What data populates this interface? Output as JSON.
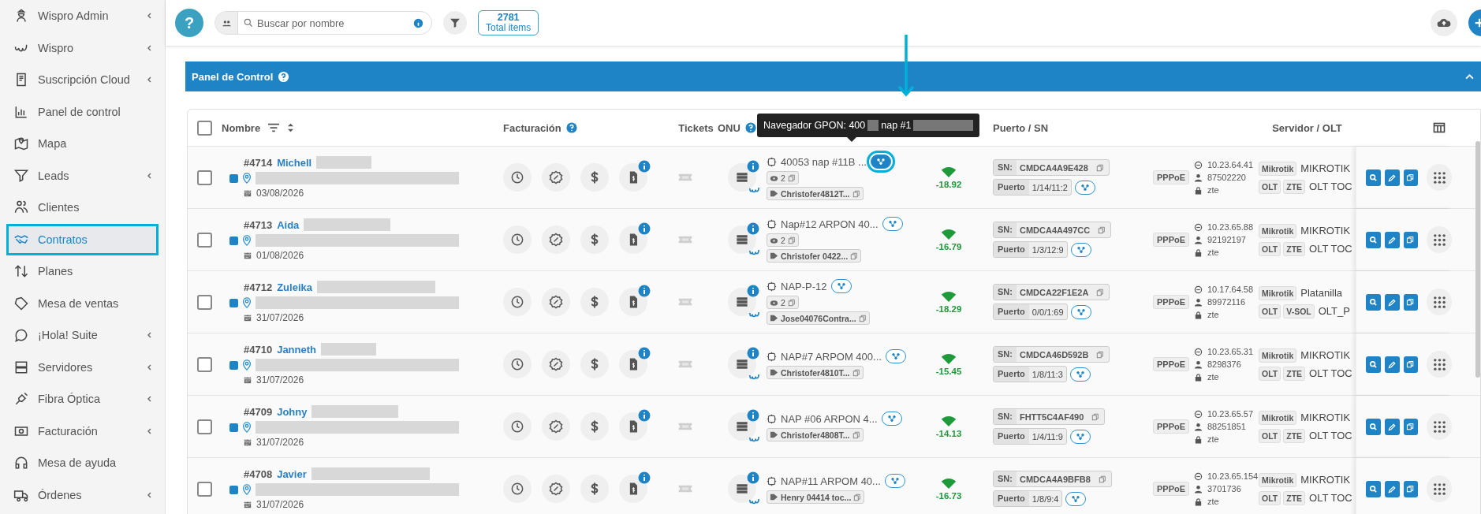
{
  "sidebar": {
    "items": [
      {
        "label": "Wispro Admin",
        "expandable": true,
        "selected": false,
        "highlighted": false
      },
      {
        "label": "Wispro",
        "expandable": true,
        "selected": false,
        "highlighted": false
      },
      {
        "label": "Suscripción Cloud",
        "expandable": true,
        "selected": false,
        "highlighted": false
      },
      {
        "label": "Panel de control",
        "expandable": false,
        "selected": false,
        "highlighted": false
      },
      {
        "label": "Mapa",
        "expandable": false,
        "selected": false,
        "highlighted": false
      },
      {
        "label": "Leads",
        "expandable": true,
        "selected": false,
        "highlighted": false
      },
      {
        "label": "Clientes",
        "expandable": false,
        "selected": false,
        "highlighted": false
      },
      {
        "label": "Contratos",
        "expandable": false,
        "selected": true,
        "highlighted": true
      },
      {
        "label": "Planes",
        "expandable": false,
        "selected": false,
        "highlighted": false
      },
      {
        "label": "Mesa de ventas",
        "expandable": false,
        "selected": false,
        "highlighted": false
      },
      {
        "label": "¡Hola! Suite",
        "expandable": true,
        "selected": false,
        "highlighted": false
      },
      {
        "label": "Servidores",
        "expandable": true,
        "selected": false,
        "highlighted": false
      },
      {
        "label": "Fibra Óptica",
        "expandable": true,
        "selected": false,
        "highlighted": false
      },
      {
        "label": "Facturación",
        "expandable": true,
        "selected": false,
        "highlighted": false
      },
      {
        "label": "Mesa de ayuda",
        "expandable": false,
        "selected": false,
        "highlighted": false
      },
      {
        "label": "Órdenes",
        "expandable": true,
        "selected": false,
        "highlighted": false
      }
    ]
  },
  "toolbar": {
    "help": "?",
    "search": {
      "placeholder": "Buscar por nombre"
    },
    "total": {
      "count": "2781",
      "label": "Total items"
    }
  },
  "panel": {
    "title": "Panel de Control"
  },
  "table": {
    "select_all_checked": false,
    "columns": [
      {
        "label": "Nombre"
      },
      {
        "label": "Facturación"
      },
      {
        "label": "Tickets"
      },
      {
        "label": "ONU"
      },
      {
        "label": "Puerto / SN"
      },
      {
        "label": "Servidor / OLT"
      }
    ],
    "tooltip": {
      "prefix": "Navegador GPON: 400",
      "middle": "nap #1"
    },
    "rows": [
      {
        "checked": false,
        "number": "#4714",
        "name": "Michell",
        "color": "#1e84c6",
        "date": "03/08/2026",
        "nap": "40053 nap #11B ...",
        "nap_highlighted": true,
        "onu_count": "2",
        "tag": "Christofer4812T...",
        "signal": "-18.92",
        "sn_label": "SN:",
        "sn": "CMDCA4A9E428",
        "port_label": "Puerto",
        "port": "1/14/11:2",
        "service": "PPPoE",
        "ip": "10.23.64.41",
        "user": "87502220",
        "password": "zte",
        "server_tag": "Mikrotik",
        "server": "MIKROTIK",
        "olt_tags": [
          "OLT",
          "ZTE"
        ],
        "olt": "OLT TOC"
      },
      {
        "checked": false,
        "number": "#4713",
        "name": "Aida",
        "color": "#1e84c6",
        "date": "01/08/2026",
        "nap": "Nap#12 ARPON 40...",
        "nap_highlighted": false,
        "onu_count": "2",
        "tag": "Christofer 0422...",
        "signal": "-16.79",
        "sn_label": "SN:",
        "sn": "CMDCA4A497CC",
        "port_label": "Puerto",
        "port": "1/3/12:9",
        "service": "PPPoE",
        "ip": "10.23.65.88",
        "user": "92192197",
        "password": "zte",
        "server_tag": "Mikrotik",
        "server": "MIKROTIK",
        "olt_tags": [
          "OLT",
          "ZTE"
        ],
        "olt": "OLT TOC"
      },
      {
        "checked": false,
        "number": "#4712",
        "name": "Zuleika",
        "color": "#1e84c6",
        "date": "31/07/2026",
        "nap": "NAP-P-12",
        "nap_highlighted": false,
        "onu_count": "2",
        "tag": "Jose04076Contra...",
        "signal": "-18.29",
        "sn_label": "SN:",
        "sn": "CMDCA22F1E2A",
        "port_label": "Puerto",
        "port": "0/0/1:69",
        "service": "PPPoE",
        "ip": "10.17.64.58",
        "user": "89972116",
        "password": "zte",
        "server_tag": "Mikrotik",
        "server": "Platanilla",
        "olt_tags": [
          "OLT",
          "V-SOL"
        ],
        "olt": "OLT_P"
      },
      {
        "checked": false,
        "number": "#4710",
        "name": "Janneth",
        "color": "#1e84c6",
        "date": "31/07/2026",
        "nap": "NAP#7 ARPOM 400...",
        "nap_highlighted": false,
        "tag": "Christofer4810T...",
        "signal": "-15.45",
        "sn_label": "SN:",
        "sn": "CMDCA46D592B",
        "port_label": "Puerto",
        "port": "1/8/11:3",
        "service": "PPPoE",
        "ip": "10.23.65.31",
        "user": "8298376",
        "password": "zte",
        "server_tag": "Mikrotik",
        "server": "MIKROTIK",
        "olt_tags": [
          "OLT",
          "ZTE"
        ],
        "olt": "OLT TOC"
      },
      {
        "checked": false,
        "number": "#4709",
        "name": "Johny",
        "color": "#1e84c6",
        "date": "31/07/2026",
        "nap": "NAP #06 ARPON 4...",
        "nap_highlighted": false,
        "tag": "Christofer4808T...",
        "signal": "-14.13",
        "sn_label": "SN:",
        "sn": "FHTT5C4AF490",
        "port_label": "Puerto",
        "port": "1/4/11:9",
        "service": "PPPoE",
        "ip": "10.23.65.57",
        "user": "88251851",
        "password": "zte",
        "server_tag": "Mikrotik",
        "server": "MIKROTIK",
        "olt_tags": [
          "OLT",
          "ZTE"
        ],
        "olt": "OLT TOC"
      },
      {
        "checked": false,
        "number": "#4708",
        "name": "Javier",
        "color": "#1e84c6",
        "date": "31/07/2026",
        "nap": "NAP#11 ARPOM 40...",
        "nap_highlighted": false,
        "tag": "Henry 04414 toc...",
        "signal": "-16.73",
        "sn_label": "SN:",
        "sn": "CMDCA4A9BFB8",
        "port_label": "Puerto",
        "port": "1/8/9:4",
        "service": "PPPoE",
        "ip": "10.23.65.154",
        "user": "3701736",
        "password": "zte",
        "server_tag": "Mikrotik",
        "server": "MIKROTIK",
        "olt_tags": [
          "OLT",
          "ZTE"
        ],
        "olt": "OLT TOC"
      }
    ]
  }
}
